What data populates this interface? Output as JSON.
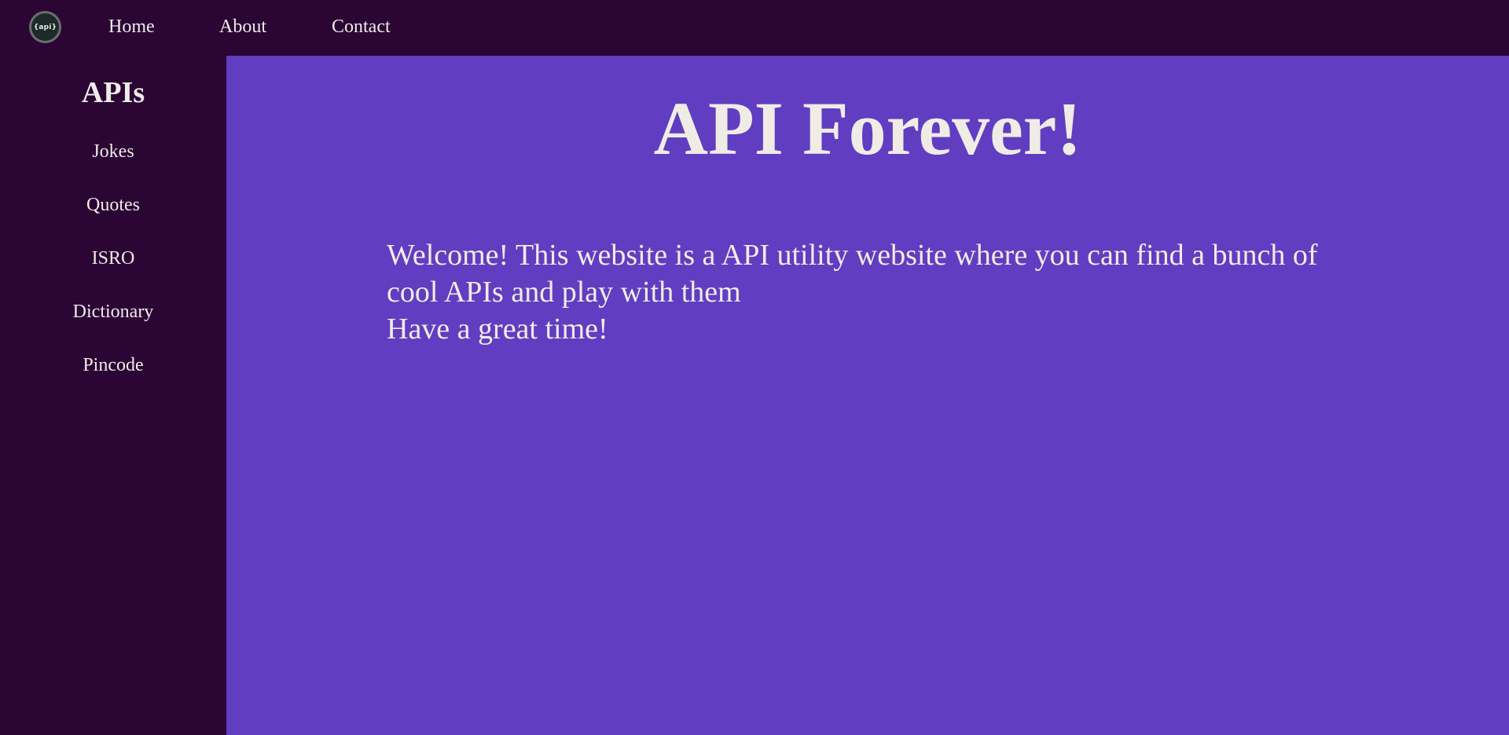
{
  "header": {
    "logo_text": "{api}",
    "nav": {
      "home": "Home",
      "about": "About",
      "contact": "Contact"
    }
  },
  "sidebar": {
    "title": "APIs",
    "items": [
      {
        "label": "Jokes"
      },
      {
        "label": "Quotes"
      },
      {
        "label": "ISRO"
      },
      {
        "label": "Dictionary"
      },
      {
        "label": "Pincode"
      }
    ]
  },
  "main": {
    "title": "API Forever!",
    "welcome_line1": "Welcome! This website is a API utility website where you can find a bunch of cool APIs and play with them",
    "welcome_line2": "Have a great time!"
  },
  "colors": {
    "nav_background": "#2b0635",
    "main_background": "#613dc1",
    "text": "#efece6"
  }
}
